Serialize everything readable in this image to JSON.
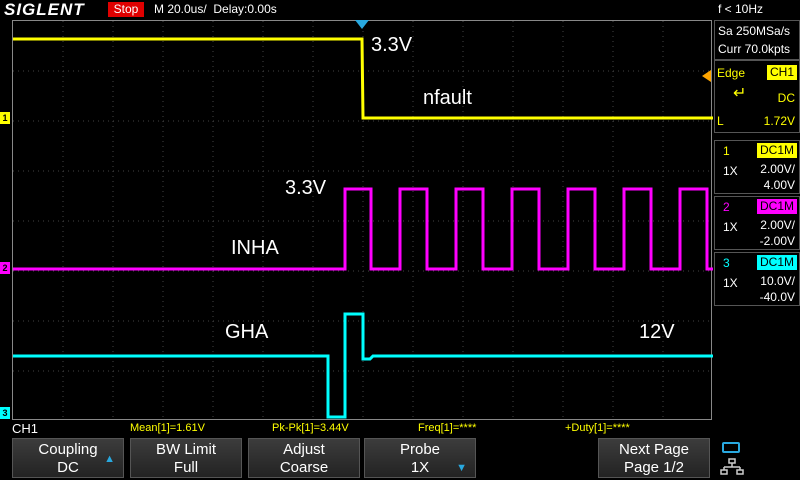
{
  "header": {
    "logo": "SIGLENT",
    "run_state": "Stop",
    "timebase": "M 20.0us/",
    "delay": "Delay:0.00s",
    "trigger_freq": "f < 10Hz"
  },
  "acquisition": {
    "sample_rate": "Sa 250MSa/s",
    "memory": "Curr 70.0kpts"
  },
  "trigger": {
    "type": "Edge",
    "source": "CH1",
    "coupling": "DC",
    "slope_label": "L",
    "level": "1.72V"
  },
  "channels": [
    {
      "num": "1",
      "coupling": "DC1M",
      "probe": "1X",
      "scale": "2.00V/",
      "offset": "4.00V",
      "color": "#ffff00"
    },
    {
      "num": "2",
      "coupling": "DC1M",
      "probe": "1X",
      "scale": "2.00V/",
      "offset": "-2.00V",
      "color": "#ff00ff"
    },
    {
      "num": "3",
      "coupling": "DC1M",
      "probe": "1X",
      "scale": "10.0V/",
      "offset": "-40.0V",
      "color": "#00ffff"
    }
  ],
  "annotations": {
    "ch1_level": "3.3V",
    "ch1_name": "nfault",
    "ch2_level": "3.3V",
    "ch2_name": "INHA",
    "ch3_name": "GHA",
    "ch3_level": "12V"
  },
  "measurements": {
    "channel": "CH1",
    "mean": "Mean[1]=1.61V",
    "pkpk": "Pk-Pk[1]=3.44V",
    "freq": "Freq[1]=****",
    "duty": "+Duty[1]=****"
  },
  "softkeys": {
    "coupling_title": "Coupling",
    "coupling_value": "DC",
    "bw_title": "BW Limit",
    "bw_value": "Full",
    "adjust_title": "Adjust",
    "adjust_value": "Coarse",
    "probe_title": "Probe",
    "probe_value": "1X",
    "next_title": "Next Page",
    "next_value": "Page 1/2"
  },
  "colors": {
    "ch1": "#ffff00",
    "ch2": "#ff00ff",
    "ch3": "#00ffff",
    "accent": "#29a9e0",
    "stop": "#e00000"
  }
}
